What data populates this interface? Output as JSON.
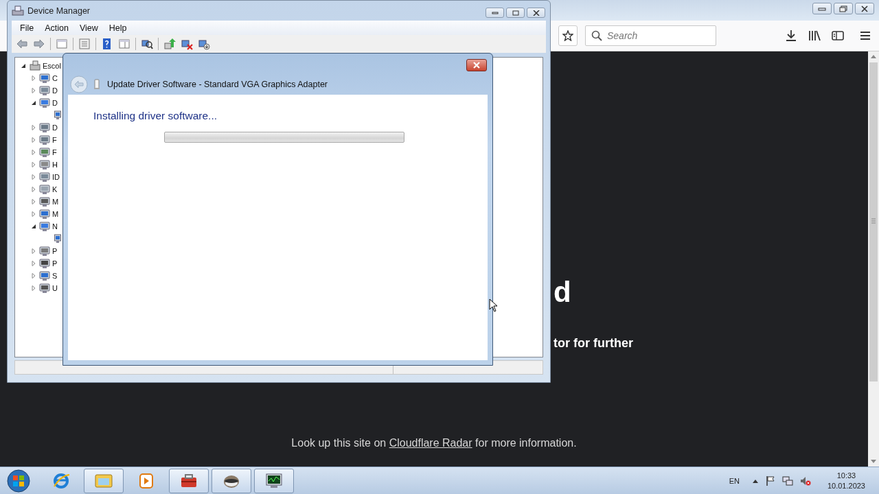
{
  "browser": {
    "search": {
      "placeholder": "Search"
    },
    "heading_fragment": "d",
    "message_fragment": "tor for further",
    "footer": {
      "before": "Look up this site on ",
      "link": "Cloudflare Radar",
      "after": " for more information."
    }
  },
  "device_manager": {
    "title": "Device Manager",
    "menu": [
      "File",
      "Action",
      "View",
      "Help"
    ],
    "tree": {
      "label": "Escol",
      "expanded": true,
      "children": [
        {
          "label": "C",
          "expanded": false
        },
        {
          "label": "D",
          "expanded": false
        },
        {
          "label": "D",
          "expanded": true
        },
        {
          "label": "D",
          "expanded": false
        },
        {
          "label": "F",
          "expanded": false
        },
        {
          "label": "F",
          "expanded": false
        },
        {
          "label": "H",
          "expanded": false
        },
        {
          "label": "ID",
          "expanded": false
        },
        {
          "label": "K",
          "expanded": false
        },
        {
          "label": "M",
          "expanded": false
        },
        {
          "label": "M",
          "expanded": false
        },
        {
          "label": "N",
          "expanded": true
        },
        {
          "label": "P",
          "expanded": false
        },
        {
          "label": "P",
          "expanded": false
        },
        {
          "label": "S",
          "expanded": false
        },
        {
          "label": "U",
          "expanded": false
        }
      ]
    }
  },
  "dialog": {
    "title": "Update Driver Software - Standard VGA Graphics Adapter",
    "status": "Installing driver software..."
  },
  "taskbar": {
    "apps": [
      {
        "running": false
      },
      {
        "running": true
      },
      {
        "running": false
      },
      {
        "running": true
      },
      {
        "running": true
      },
      {
        "running": true
      }
    ],
    "language": "EN",
    "time": "10:33",
    "date": "10.01.2023"
  }
}
